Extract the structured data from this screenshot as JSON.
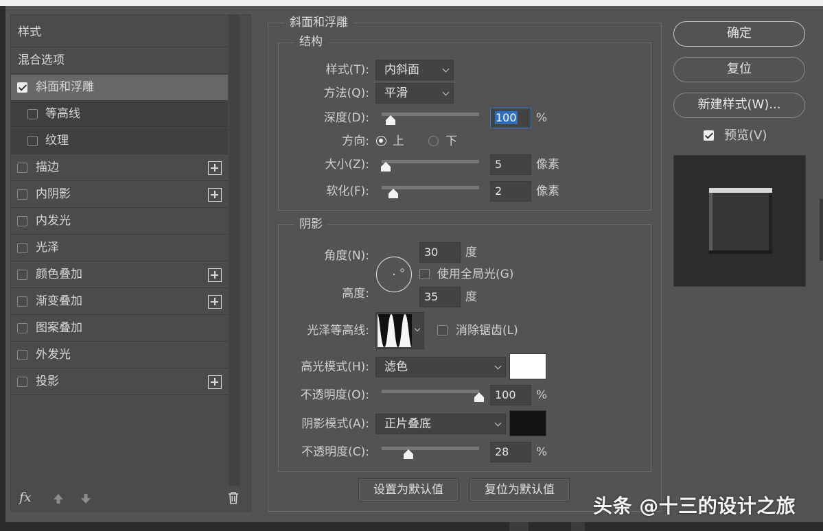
{
  "left_panel": {
    "items": [
      {
        "label": "样式",
        "kind": "plain"
      },
      {
        "label": "混合选项",
        "kind": "plain"
      },
      {
        "label": "斜面和浮雕",
        "kind": "checkbox",
        "checked": true,
        "selected": true
      },
      {
        "label": "等高线",
        "kind": "sub",
        "checked": false
      },
      {
        "label": "纹理",
        "kind": "sub",
        "checked": false
      },
      {
        "label": "描边",
        "kind": "checkbox",
        "checked": false,
        "plus": true
      },
      {
        "label": "内阴影",
        "kind": "checkbox",
        "checked": false,
        "plus": true
      },
      {
        "label": "内发光",
        "kind": "checkbox",
        "checked": false
      },
      {
        "label": "光泽",
        "kind": "checkbox",
        "checked": false
      },
      {
        "label": "颜色叠加",
        "kind": "checkbox",
        "checked": false,
        "plus": true
      },
      {
        "label": "渐变叠加",
        "kind": "checkbox",
        "checked": false,
        "plus": true
      },
      {
        "label": "图案叠加",
        "kind": "checkbox",
        "checked": false
      },
      {
        "label": "外发光",
        "kind": "checkbox",
        "checked": false
      },
      {
        "label": "投影",
        "kind": "checkbox",
        "checked": false,
        "plus": true
      }
    ],
    "fx_label": "fx"
  },
  "bevel": {
    "section_title": "斜面和浮雕",
    "structure": {
      "title": "结构",
      "style_label": "样式(T):",
      "style_value": "内斜面",
      "technique_label": "方法(Q):",
      "technique_value": "平滑",
      "depth_label": "深度(D):",
      "depth_value": "100",
      "depth_unit": "%",
      "direction_label": "方向:",
      "direction_up": "上",
      "direction_down": "下",
      "size_label": "大小(Z):",
      "size_value": "5",
      "size_unit": "像素",
      "soften_label": "软化(F):",
      "soften_value": "2",
      "soften_unit": "像素"
    },
    "shading": {
      "title": "阴影",
      "angle_label": "角度(N):",
      "angle_value": "30",
      "angle_unit": "度",
      "global_light_label": "使用全局光(G)",
      "altitude_label": "高度:",
      "altitude_value": "35",
      "altitude_unit": "度",
      "gloss_contour_label": "光泽等高线:",
      "anti_alias_label": "消除锯齿(L)",
      "highlight_mode_label": "高光模式(H):",
      "highlight_mode_value": "滤色",
      "highlight_color": "#ffffff",
      "highlight_opacity_label": "不透明度(O):",
      "highlight_opacity_value": "100",
      "highlight_opacity_unit": "%",
      "shadow_mode_label": "阴影模式(A):",
      "shadow_mode_value": "正片叠底",
      "shadow_color": "#141414",
      "shadow_opacity_label": "不透明度(C):",
      "shadow_opacity_value": "28",
      "shadow_opacity_unit": "%"
    },
    "make_default": "设置为默认值",
    "reset_default": "复位为默认值"
  },
  "actions": {
    "ok": "确定",
    "reset": "复位",
    "new_style": "新建样式(W)...",
    "preview_label": "预览(V)"
  },
  "watermark": "头条 @十三的设计之旅"
}
